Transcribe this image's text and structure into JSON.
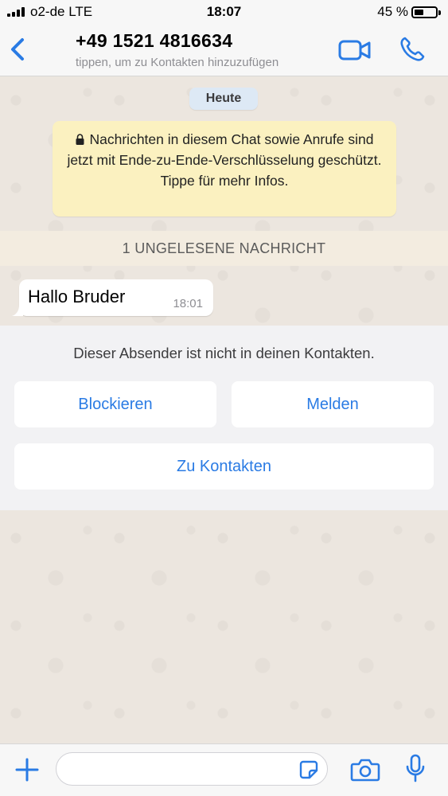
{
  "status_bar": {
    "carrier": "o2-de  LTE",
    "time": "18:07",
    "battery": "45 %",
    "battery_level": 0.45
  },
  "header": {
    "back_icon": "chevron-left-icon",
    "contact_name": "+49 1521 4816634",
    "subtitle": "tippen, um zu Kontakten hinzuzufügen",
    "video_icon": "video-camera-icon",
    "phone_icon": "phone-icon"
  },
  "chat": {
    "date_label": "Heute",
    "encryption_notice": "Nachrichten in diesem Chat sowie Anrufe sind jetzt mit Ende-zu-Ende-Verschlüsselung geschützt. Tippe für mehr Infos.",
    "unread_label": "1 UNGELESENE NACHRICHT",
    "messages": [
      {
        "text": "Hallo Bruder",
        "time": "18:01"
      }
    ]
  },
  "unknown_sender": {
    "notice": "Dieser Absender ist nicht in deinen Kontakten.",
    "block_label": "Blockieren",
    "report_label": "Melden",
    "add_contact_label": "Zu Kontakten"
  },
  "input_bar": {
    "placeholder": "",
    "icons": [
      "plus-icon",
      "sticker-icon",
      "camera-icon",
      "microphone-icon"
    ]
  },
  "colors": {
    "accent": "#2a7be4",
    "notice_bg": "#fbf1c0",
    "date_chip_bg": "#dde9f5"
  }
}
